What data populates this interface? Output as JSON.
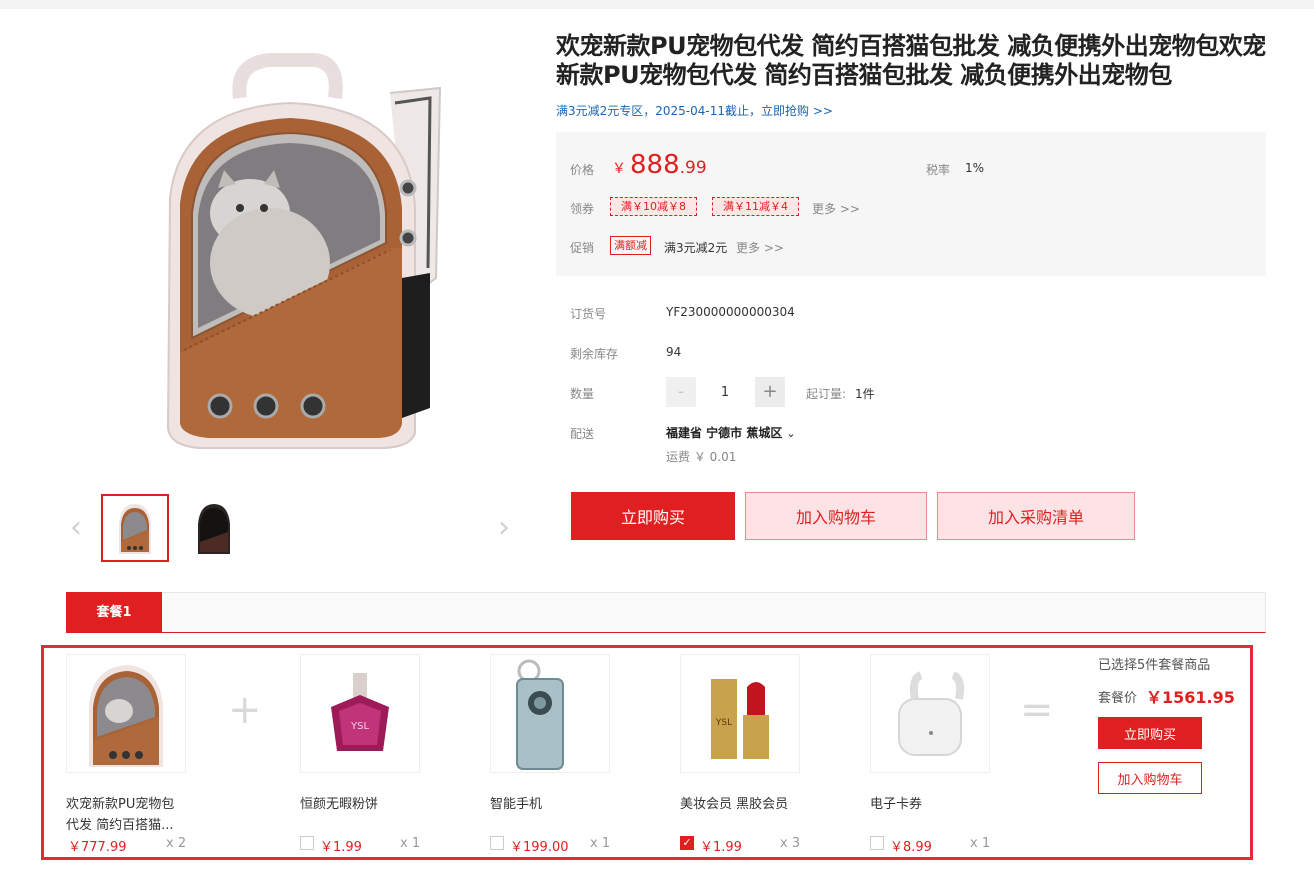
{
  "product": {
    "title": "欢宠新款PU宠物包代发 简约百搭猫包批发 减负便携外出宠物包欢宠新款PU宠物包代发 简约百搭猫包批发 减负便携外出宠物包",
    "promo_link": "满3元减2元专区，2025-04-11截止，立即抢购 >>"
  },
  "price_box": {
    "price_label": "价格",
    "currency": "￥",
    "price_int": "888",
    "price_dec": ".99",
    "tax_label": "税率",
    "tax_value": "1%",
    "coupon_label": "领券",
    "coupons": [
      "满￥10减￥8",
      "满￥11减￥4"
    ],
    "coupon_more": "更多 >>",
    "promo_label": "促销",
    "promo_tag": "满额减",
    "promo_text": "满3元减2元",
    "promo_more": "更多 >>"
  },
  "details": {
    "sku_label": "订货号",
    "sku_value": "YF230000000000304",
    "stock_label": "剩余库存",
    "stock_value": "94",
    "qty_label": "数量",
    "qty_minus": "-",
    "qty_value": "1",
    "qty_plus": "+",
    "min_order_label": "起订量:",
    "min_order_value": "1件",
    "ship_label": "配送",
    "region": "福建省 宁德市 蕉城区",
    "shipping_fee": "运费 ￥ 0.01"
  },
  "actions": {
    "buy_now": "立即购买",
    "add_cart": "加入购物车",
    "add_purchase_list": "加入采购清单"
  },
  "bundle": {
    "tab_label": "套餐1",
    "items": [
      {
        "name_line1": "欢宠新款PU宠物包",
        "name_line2": "代发 简约百搭猫...",
        "price": "￥777.99",
        "qty": "x 2",
        "icon": "cat-backpack-image"
      },
      {
        "name_line1": "恒颜无暇粉饼",
        "price": "￥1.99",
        "qty": "x 1",
        "checked": false,
        "icon": "perfume-image"
      },
      {
        "name_line1": "智能手机",
        "price": "￥199.00",
        "qty": "x 1",
        "checked": false,
        "icon": "phone-image"
      },
      {
        "name_line1": "美妆会员 黑胶会员",
        "price": "￥1.99",
        "qty": "x 3",
        "checked": true,
        "icon": "lipstick-image"
      },
      {
        "name_line1": "电子卡券",
        "price": "￥8.99",
        "qty": "x 1",
        "checked": false,
        "icon": "earbuds-image"
      }
    ],
    "plus": "+",
    "equals": "=",
    "selected_text": "已选择5件套餐商品",
    "bundle_price_label": "套餐价",
    "bundle_price": "￥1561.95",
    "buy_now": "立即购买",
    "add_cart": "加入购物车"
  },
  "colors": {
    "accent": "#e02020",
    "price_bg": "#f6f6f6",
    "link": "#1a64b4"
  }
}
